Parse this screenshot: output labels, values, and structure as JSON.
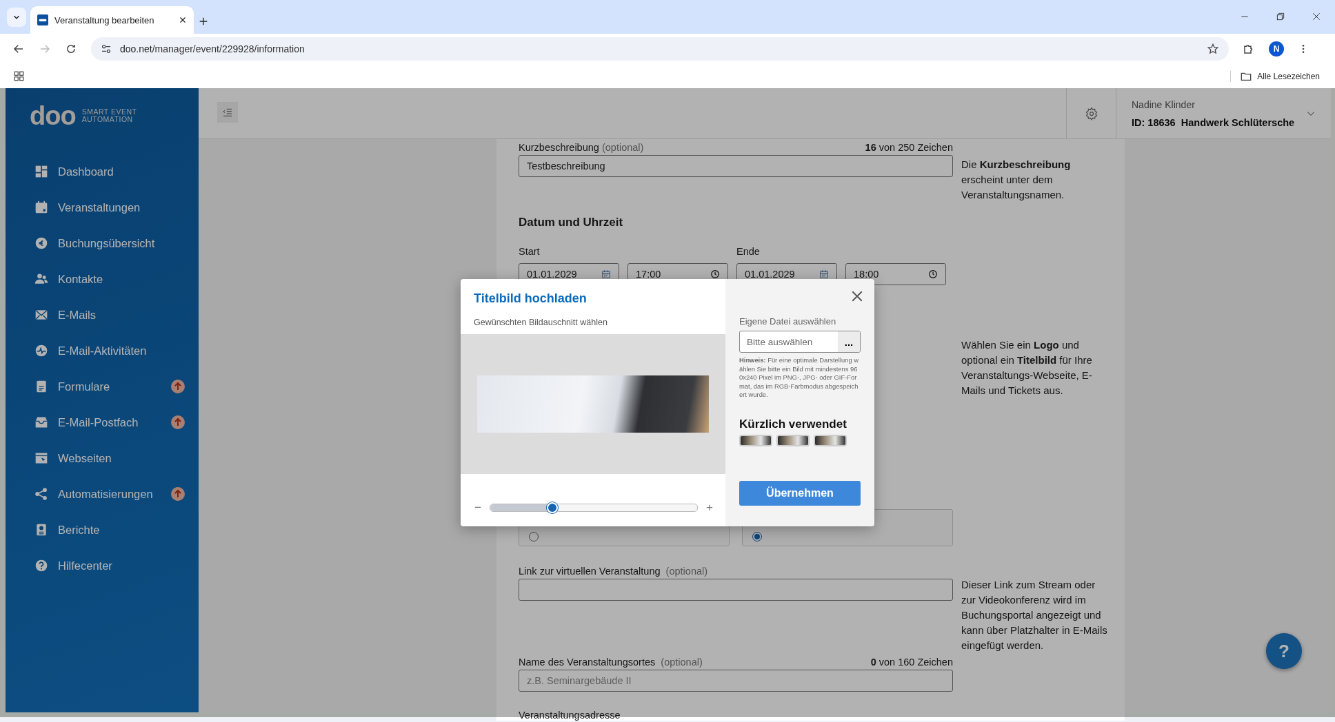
{
  "browser": {
    "tab_title": "Veranstaltung bearbeiten",
    "url_host": "doo.net",
    "url_path": "/manager/event/229928/information",
    "profile_initial": "N",
    "bookmarks_label": "Alle Lesezeichen",
    "forward_disabled": true
  },
  "sidebar": {
    "logo_word": "doo",
    "logo_tagline_1": "SMART EVENT",
    "logo_tagline_2": "AUTOMATION",
    "items": [
      {
        "label": "Dashboard",
        "kind": "dashboard",
        "selected": false,
        "badge": false
      },
      {
        "label": "Veranstaltungen",
        "kind": "calendar",
        "selected": false,
        "badge": false
      },
      {
        "label": "Buchungsübersicht",
        "kind": "coin",
        "selected": false,
        "badge": false
      },
      {
        "label": "Kontakte",
        "kind": "people",
        "selected": false,
        "badge": false
      },
      {
        "label": "E-Mails",
        "kind": "mail",
        "selected": false,
        "badge": false
      },
      {
        "label": "E-Mail-Aktivitäten",
        "kind": "pulse",
        "selected": false,
        "badge": false
      },
      {
        "label": "Formulare",
        "kind": "document",
        "selected": false,
        "badge": true
      },
      {
        "label": "E-Mail-Postfach",
        "kind": "inbox",
        "selected": false,
        "badge": true
      },
      {
        "label": "Webseiten",
        "kind": "browser",
        "selected": false,
        "badge": false
      },
      {
        "label": "Automatisierungen",
        "kind": "share",
        "selected": false,
        "badge": true
      },
      {
        "label": "Berichte",
        "kind": "report",
        "selected": false,
        "badge": false
      },
      {
        "label": "Hilfecenter",
        "kind": "help",
        "selected": false,
        "badge": false
      }
    ]
  },
  "header": {
    "user_name": "Nadine Klinder",
    "account": "ID: 18636  Handwerk Schlütersche"
  },
  "form": {
    "short_description": {
      "label": "Kurzbeschreibung",
      "optional": "(optional)",
      "counter": "**16** von 250 Zeichen",
      "value": "Testbeschreibung",
      "help": "Die **Kurzbeschreibung** erscheint unter dem Veranstaltungsnamen."
    },
    "date_time": {
      "heading": "Datum und Uhrzeit",
      "start_label": "Start",
      "start_date": "01.01.2029",
      "start_time": "17:00",
      "end_label": "Ende",
      "end_date": "01.01.2029",
      "end_time": "18:00"
    },
    "images_help": "Wählen Sie ein **Logo** und optional ein **Titelbild** für Ihre Veranstaltungs-Webseite, E-Mails und Tickets aus.",
    "location_type": [
      {
        "selected": false
      },
      {
        "selected": true
      }
    ],
    "virtual_link": {
      "label": "Link zur virtuellen Veranstaltung",
      "optional": "(optional)",
      "help": "Dieser Link zum Stream oder zur Videokonferenz wird im Buchungsportal angezeigt und kann über Platzhalter in E-Mails eingefügt werden."
    },
    "venue_name": {
      "label": "Name des Veranstaltungsortes",
      "optional": "(optional)",
      "counter": "**0** von 160 Zeichen",
      "placeholder": "z.B. Seminargebäude II"
    },
    "address_label": "Veranstaltungsadresse"
  },
  "help_button": "?",
  "modal": {
    "title": "Titelbild hochladen",
    "subtitle": "Gewünschten Bildauschnitt wählen",
    "zoom_minus": "−",
    "zoom_plus": "+",
    "level": 0.3,
    "file_label": "Eigene Datei auswählen",
    "file_placeholder": "Bitte auswählen",
    "browse": "...",
    "hint": "**Hinweis:** Für eine optimale Darstellung wählen Sie bitte ein Bild mit mindestens 960x240 Pixel im PNG-, JPG- oder GIF-Format, das im RGB-Farbmodus abgespeichert wurde.",
    "recent_title": "Kürzlich verwendet",
    "recent": [
      {
        "selected": false
      },
      {
        "selected": false
      },
      {
        "selected": false
      }
    ],
    "apply": "Übernehmen"
  }
}
